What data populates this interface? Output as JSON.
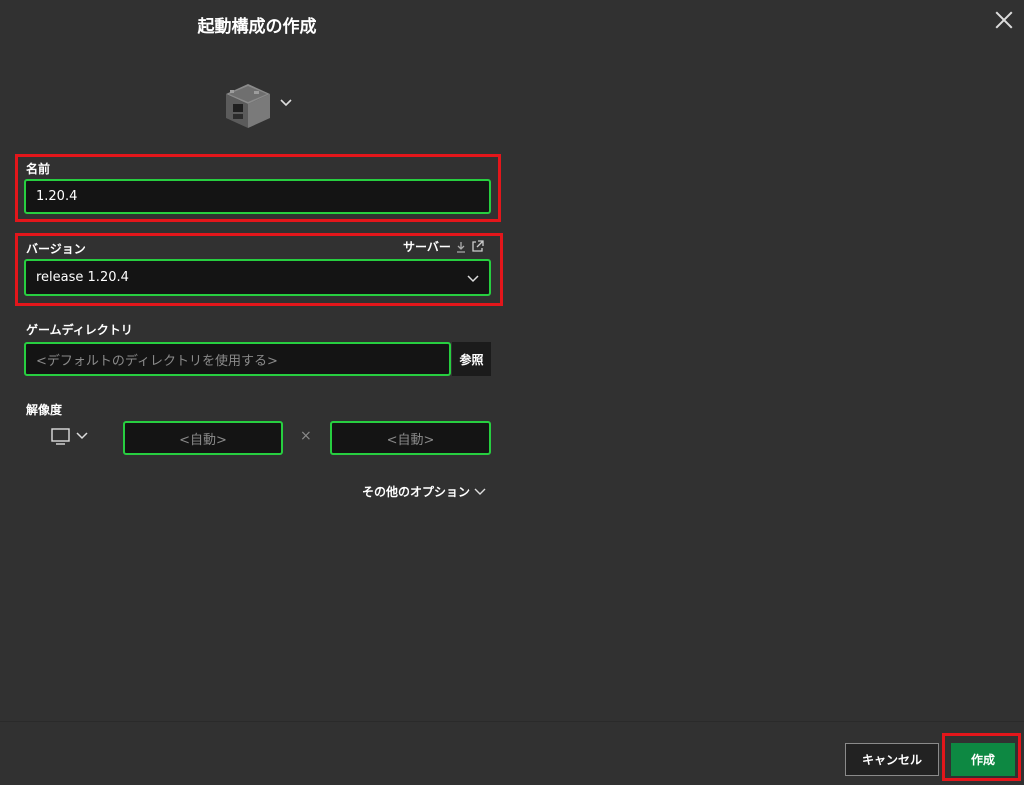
{
  "dialog": {
    "title": "起動構成の作成"
  },
  "name_section": {
    "label": "名前",
    "value": "1.20.4"
  },
  "version_section": {
    "label": "バージョン",
    "server_link": "サーバー",
    "selected": "release 1.20.4"
  },
  "game_dir": {
    "label": "ゲームディレクトリ",
    "placeholder": "<デフォルトのディレクトリを使用する>",
    "browse": "参照"
  },
  "resolution": {
    "label": "解像度",
    "width_placeholder": "<自動>",
    "times": "×",
    "height_placeholder": "<自動>"
  },
  "more_options": "その他のオプション",
  "footer": {
    "cancel": "キャンセル",
    "create": "作成"
  },
  "colors": {
    "accent_green": "#27ce40",
    "button_green": "#0d8842",
    "highlight_red": "#e3161b"
  },
  "icons": [
    "furnace-icon",
    "chevron-down-icon",
    "close-icon",
    "download-icon",
    "external-link-icon",
    "monitor-icon"
  ]
}
